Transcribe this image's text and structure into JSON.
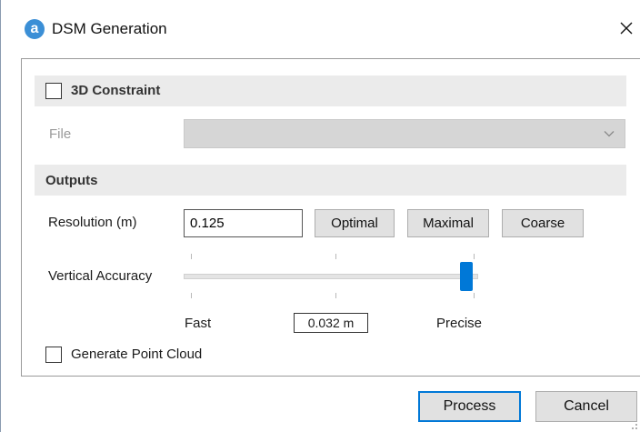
{
  "window": {
    "title": "DSM Generation",
    "app_icon_letter": "a",
    "close_icon": "close-icon"
  },
  "constraint": {
    "checkbox_label": "3D Constraint",
    "checked": false
  },
  "file": {
    "label": "File",
    "value": "",
    "enabled": false
  },
  "outputs": {
    "section_label": "Outputs",
    "resolution_label": "Resolution  (m)",
    "resolution_value": "0.125",
    "buttons": {
      "optimal": "Optimal",
      "maximal": "Maximal",
      "coarse": "Coarse"
    },
    "vertical_accuracy": {
      "label": "Vertical Accuracy",
      "min_label": "Fast",
      "max_label": "Precise",
      "value_display": "0.032 m",
      "slider_position": 1.0
    },
    "point_cloud": {
      "label": "Generate Point Cloud",
      "checked": false
    }
  },
  "footer": {
    "process_label": "Process",
    "cancel_label": "Cancel"
  },
  "colors": {
    "accent": "#0078d7",
    "app_icon": "#3b8fd6",
    "section_bg": "#ebebeb"
  }
}
